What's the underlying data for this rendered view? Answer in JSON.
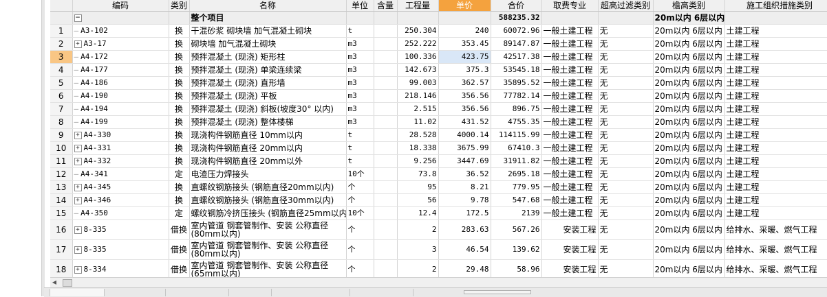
{
  "columns": [
    "编码",
    "类别",
    "名称",
    "单位",
    "含量",
    "工程量",
    "单价",
    "合价",
    "取费专业",
    "超高过滤类别",
    "檐高类别",
    "施工组织措施类别"
  ],
  "total_row": {
    "expander": "−",
    "name": "整个项目",
    "amount": "588235.32",
    "eave": "20m以内 6层以内"
  },
  "rows": [
    {
      "num": "1",
      "code": "A3-102",
      "type": "换",
      "name": "干混砂浆 砌块墙 加气混凝土砌块",
      "unit": "t",
      "qty": "250.304",
      "price": "240",
      "amount": "60072.96",
      "prof": "一般土建工程",
      "filter": "无",
      "eave": "20m以内 6层以内",
      "org": "土建工程"
    },
    {
      "num": "2",
      "code": "A3-17",
      "type": "换",
      "name": "砌块墙 加气混凝土砌块",
      "unit": "m3",
      "qty": "252.222",
      "price": "353.45",
      "amount": "89147.87",
      "prof": "一般土建工程",
      "filter": "无",
      "eave": "20m以内 6层以内",
      "org": "土建工程"
    },
    {
      "num": "3",
      "code": "A4-172",
      "type": "换",
      "name": "预拌混凝土 (现浇) 矩形柱",
      "unit": "m3",
      "qty": "100.336",
      "price": "423.75",
      "amount": "42517.38",
      "prof": "一般土建工程",
      "filter": "无",
      "eave": "20m以内 6层以内",
      "org": "土建工程"
    },
    {
      "num": "4",
      "code": "A4-177",
      "type": "换",
      "name": "预拌混凝土 (现浇) 单梁连续梁",
      "unit": "m3",
      "qty": "142.673",
      "price": "375.3",
      "amount": "53545.18",
      "prof": "一般土建工程",
      "filter": "无",
      "eave": "20m以内 6层以内",
      "org": "土建工程"
    },
    {
      "num": "5",
      "code": "A4-186",
      "type": "换",
      "name": "预拌混凝土 (现浇) 直形墙",
      "unit": "m3",
      "qty": "99.003",
      "price": "362.57",
      "amount": "35895.52",
      "prof": "一般土建工程",
      "filter": "无",
      "eave": "20m以内 6层以内",
      "org": "土建工程"
    },
    {
      "num": "6",
      "code": "A4-190",
      "type": "换",
      "name": "预拌混凝土 (现浇) 平板",
      "unit": "m3",
      "qty": "218.146",
      "price": "356.56",
      "amount": "77782.14",
      "prof": "一般土建工程",
      "filter": "无",
      "eave": "20m以内 6层以内",
      "org": "土建工程"
    },
    {
      "num": "7",
      "code": "A4-194",
      "type": "换",
      "name": "预拌混凝土 (现浇) 斜板(坡度30° 以内)",
      "unit": "m3",
      "qty": "2.515",
      "price": "356.56",
      "amount": "896.75",
      "prof": "一般土建工程",
      "filter": "无",
      "eave": "20m以内 6层以内",
      "org": "土建工程"
    },
    {
      "num": "8",
      "code": "A4-199",
      "type": "换",
      "name": "预拌混凝土 (现浇) 整体楼梯",
      "unit": "m3",
      "qty": "11.02",
      "price": "431.52",
      "amount": "4755.35",
      "prof": "一般土建工程",
      "filter": "无",
      "eave": "20m以内 6层以内",
      "org": "土建工程"
    },
    {
      "num": "9",
      "code": "A4-330",
      "type": "换",
      "name": "现浇构件钢筋直径 10mm以内",
      "unit": "t",
      "qty": "28.528",
      "price": "4000.14",
      "amount": "114115.99",
      "prof": "一般土建工程",
      "filter": "无",
      "eave": "20m以内 6层以内",
      "org": "土建工程"
    },
    {
      "num": "10",
      "code": "A4-331",
      "type": "换",
      "name": "现浇构件钢筋直径 20mm以内",
      "unit": "t",
      "qty": "18.338",
      "price": "3675.99",
      "amount": "67410.3",
      "prof": "一般土建工程",
      "filter": "无",
      "eave": "20m以内 6层以内",
      "org": "土建工程"
    },
    {
      "num": "11",
      "code": "A4-332",
      "type": "换",
      "name": "现浇构件钢筋直径 20mm以外",
      "unit": "t",
      "qty": "9.256",
      "price": "3447.69",
      "amount": "31911.82",
      "prof": "一般土建工程",
      "filter": "无",
      "eave": "20m以内 6层以内",
      "org": "土建工程"
    },
    {
      "num": "12",
      "code": "A4-341",
      "type": "定",
      "name": "电渣压力焊接头",
      "unit": "10个",
      "qty": "73.8",
      "price": "36.52",
      "amount": "2695.18",
      "prof": "一般土建工程",
      "filter": "无",
      "eave": "20m以内 6层以内",
      "org": "土建工程"
    },
    {
      "num": "13",
      "code": "A4-345",
      "type": "换",
      "name": "直螺纹钢筋接头 (钢筋直径20mm以内)",
      "unit": "个",
      "qty": "95",
      "price": "8.21",
      "amount": "779.95",
      "prof": "一般土建工程",
      "filter": "无",
      "eave": "20m以内 6层以内",
      "org": "土建工程"
    },
    {
      "num": "14",
      "code": "A4-346",
      "type": "换",
      "name": "直螺纹钢筋接头 (钢筋直径30mm以内)",
      "unit": "个",
      "qty": "56",
      "price": "9.78",
      "amount": "547.68",
      "prof": "一般土建工程",
      "filter": "无",
      "eave": "20m以内 6层以内",
      "org": "土建工程"
    },
    {
      "num": "15",
      "code": "A4-350",
      "type": "定",
      "name": "螺纹钢筋冷挤压接头 (钢筋直径25mm以内)",
      "unit": "10个",
      "qty": "12.4",
      "price": "172.5",
      "amount": "2139",
      "prof": "一般土建工程",
      "filter": "无",
      "eave": "20m以内 6层以内",
      "org": "土建工程"
    },
    {
      "num": "16",
      "code": "8-335",
      "type": "借换",
      "name": "室内管道 钢套管制作、安装 公称直径(80mm以内)",
      "unit": "个",
      "qty": "2",
      "price": "283.63",
      "amount": "567.26",
      "prof": "安装工程",
      "filter": "无",
      "eave": "20m以内 6层以内",
      "org": "给排水、采暖、燃气工程"
    },
    {
      "num": "17",
      "code": "8-335",
      "type": "借换",
      "name": "室内管道 钢套管制作、安装 公称直径(80mm以内)",
      "unit": "个",
      "qty": "3",
      "price": "46.54",
      "amount": "139.62",
      "prof": "安装工程",
      "filter": "无",
      "eave": "20m以内 6层以内",
      "org": "给排水、采暖、燃气工程"
    },
    {
      "num": "18",
      "code": "8-334",
      "type": "借换",
      "name": "室内管道 钢套管制作、安装 公称直径(65mm以内)",
      "unit": "个",
      "qty": "2",
      "price": "29.48",
      "amount": "58.96",
      "prof": "安装工程",
      "filter": "无",
      "eave": "20m以内 6层以内",
      "org": "给排水、采暖、燃气工程"
    }
  ],
  "expandable_rows": [
    "2",
    "9",
    "10",
    "11",
    "13",
    "14",
    "16",
    "17",
    "18"
  ],
  "selected_row": "3",
  "colors": {
    "header_highlight": "#f4a23e",
    "selected_rownum": "#f9c684",
    "selected_cell": "#d9e7f7"
  }
}
